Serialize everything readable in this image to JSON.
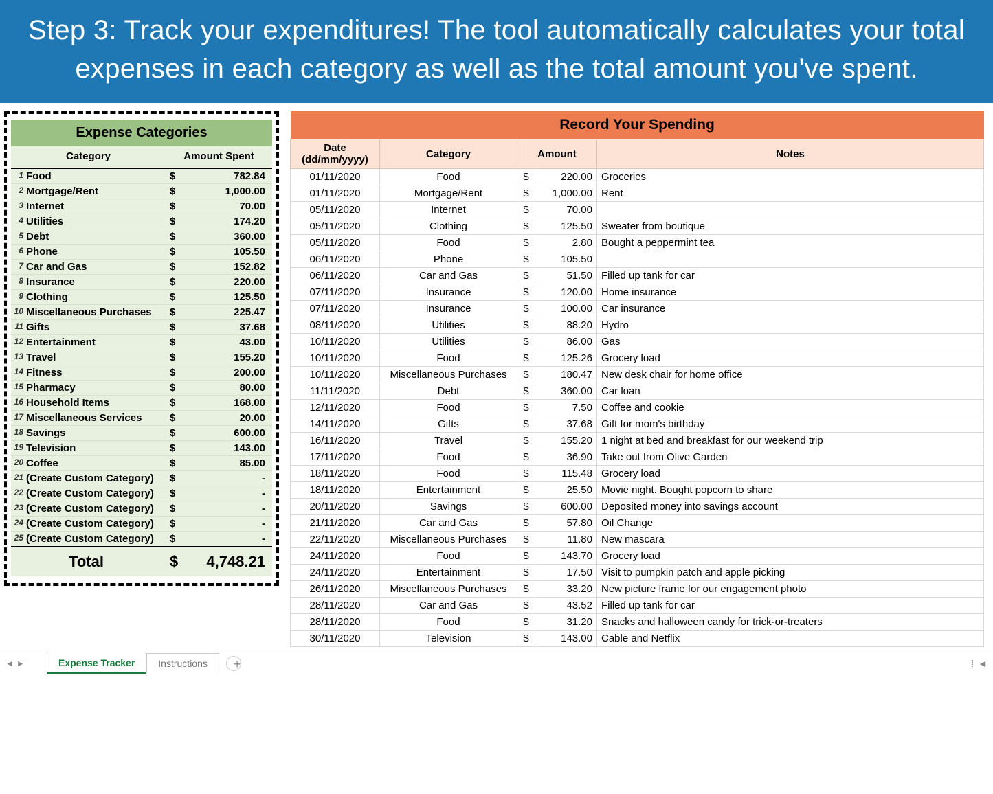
{
  "banner": "Step 3: Track your expenditures! The tool automatically calculates your total expenses in each category as well as the total amount you've spent.",
  "categories_panel": {
    "title": "Expense Categories",
    "header": {
      "category": "Category",
      "amount": "Amount Spent"
    },
    "rows": [
      {
        "n": "1",
        "name": "Food",
        "amount": "782.84"
      },
      {
        "n": "2",
        "name": "Mortgage/Rent",
        "amount": "1,000.00"
      },
      {
        "n": "3",
        "name": "Internet",
        "amount": "70.00"
      },
      {
        "n": "4",
        "name": "Utilities",
        "amount": "174.20"
      },
      {
        "n": "5",
        "name": "Debt",
        "amount": "360.00"
      },
      {
        "n": "6",
        "name": "Phone",
        "amount": "105.50"
      },
      {
        "n": "7",
        "name": "Car and Gas",
        "amount": "152.82"
      },
      {
        "n": "8",
        "name": "Insurance",
        "amount": "220.00"
      },
      {
        "n": "9",
        "name": "Clothing",
        "amount": "125.50"
      },
      {
        "n": "10",
        "name": "Miscellaneous Purchases",
        "amount": "225.47"
      },
      {
        "n": "11",
        "name": "Gifts",
        "amount": "37.68"
      },
      {
        "n": "12",
        "name": "Entertainment",
        "amount": "43.00"
      },
      {
        "n": "13",
        "name": "Travel",
        "amount": "155.20"
      },
      {
        "n": "14",
        "name": "Fitness",
        "amount": "200.00"
      },
      {
        "n": "15",
        "name": "Pharmacy",
        "amount": "80.00"
      },
      {
        "n": "16",
        "name": "Household Items",
        "amount": "168.00"
      },
      {
        "n": "17",
        "name": "Miscellaneous Services",
        "amount": "20.00"
      },
      {
        "n": "18",
        "name": "Savings",
        "amount": "600.00"
      },
      {
        "n": "19",
        "name": "Television",
        "amount": "143.00"
      },
      {
        "n": "20",
        "name": "Coffee",
        "amount": "85.00"
      },
      {
        "n": "21",
        "name": "(Create Custom Category)",
        "amount": "-"
      },
      {
        "n": "22",
        "name": "(Create Custom Category)",
        "amount": "-"
      },
      {
        "n": "23",
        "name": "(Create Custom Category)",
        "amount": "-"
      },
      {
        "n": "24",
        "name": "(Create Custom Category)",
        "amount": "-"
      },
      {
        "n": "25",
        "name": "(Create Custom Category)",
        "amount": "-"
      }
    ],
    "total_label": "Total",
    "total_currency": "$",
    "total_amount": "4,748.21"
  },
  "spending_panel": {
    "title": "Record Your Spending",
    "header": {
      "date": "Date\n(dd/mm/yyyy)",
      "category": "Category",
      "amount": "Amount",
      "notes": "Notes"
    },
    "currency": "$",
    "rows": [
      {
        "date": "01/11/2020",
        "category": "Food",
        "amount": "220.00",
        "notes": "Groceries"
      },
      {
        "date": "01/11/2020",
        "category": "Mortgage/Rent",
        "amount": "1,000.00",
        "notes": "Rent"
      },
      {
        "date": "05/11/2020",
        "category": "Internet",
        "amount": "70.00",
        "notes": ""
      },
      {
        "date": "05/11/2020",
        "category": "Clothing",
        "amount": "125.50",
        "notes": "Sweater from boutique"
      },
      {
        "date": "05/11/2020",
        "category": "Food",
        "amount": "2.80",
        "notes": "Bought a peppermint tea"
      },
      {
        "date": "06/11/2020",
        "category": "Phone",
        "amount": "105.50",
        "notes": ""
      },
      {
        "date": "06/11/2020",
        "category": "Car and Gas",
        "amount": "51.50",
        "notes": "Filled up tank for car"
      },
      {
        "date": "07/11/2020",
        "category": "Insurance",
        "amount": "120.00",
        "notes": "Home insurance"
      },
      {
        "date": "07/11/2020",
        "category": "Insurance",
        "amount": "100.00",
        "notes": "Car insurance"
      },
      {
        "date": "08/11/2020",
        "category": "Utilities",
        "amount": "88.20",
        "notes": "Hydro"
      },
      {
        "date": "10/11/2020",
        "category": "Utilities",
        "amount": "86.00",
        "notes": "Gas"
      },
      {
        "date": "10/11/2020",
        "category": "Food",
        "amount": "125.26",
        "notes": "Grocery load"
      },
      {
        "date": "10/11/2020",
        "category": "Miscellaneous Purchases",
        "amount": "180.47",
        "notes": "New desk chair for home office"
      },
      {
        "date": "11/11/2020",
        "category": "Debt",
        "amount": "360.00",
        "notes": "Car loan"
      },
      {
        "date": "12/11/2020",
        "category": "Food",
        "amount": "7.50",
        "notes": "Coffee and cookie"
      },
      {
        "date": "14/11/2020",
        "category": "Gifts",
        "amount": "37.68",
        "notes": "Gift for mom's birthday"
      },
      {
        "date": "16/11/2020",
        "category": "Travel",
        "amount": "155.20",
        "notes": "1 night at bed and breakfast for our weekend trip"
      },
      {
        "date": "17/11/2020",
        "category": "Food",
        "amount": "36.90",
        "notes": "Take out from Olive Garden"
      },
      {
        "date": "18/11/2020",
        "category": "Food",
        "amount": "115.48",
        "notes": "Grocery load"
      },
      {
        "date": "18/11/2020",
        "category": "Entertainment",
        "amount": "25.50",
        "notes": "Movie night. Bought popcorn to share"
      },
      {
        "date": "20/11/2020",
        "category": "Savings",
        "amount": "600.00",
        "notes": "Deposited money into savings account"
      },
      {
        "date": "21/11/2020",
        "category": "Car and Gas",
        "amount": "57.80",
        "notes": "Oil Change"
      },
      {
        "date": "22/11/2020",
        "category": "Miscellaneous Purchases",
        "amount": "11.80",
        "notes": "New mascara"
      },
      {
        "date": "24/11/2020",
        "category": "Food",
        "amount": "143.70",
        "notes": "Grocery load"
      },
      {
        "date": "24/11/2020",
        "category": "Entertainment",
        "amount": "17.50",
        "notes": "Visit to pumpkin patch and apple picking"
      },
      {
        "date": "26/11/2020",
        "category": "Miscellaneous Purchases",
        "amount": "33.20",
        "notes": "New picture frame for our engagement photo"
      },
      {
        "date": "28/11/2020",
        "category": "Car and Gas",
        "amount": "43.52",
        "notes": "Filled up tank for car"
      },
      {
        "date": "28/11/2020",
        "category": "Food",
        "amount": "31.20",
        "notes": "Snacks and halloween candy for trick-or-treaters"
      },
      {
        "date": "30/11/2020",
        "category": "Television",
        "amount": "143.00",
        "notes": "Cable and Netflix"
      }
    ]
  },
  "tabs": {
    "active": "Expense Tracker",
    "inactive": "Instructions"
  }
}
